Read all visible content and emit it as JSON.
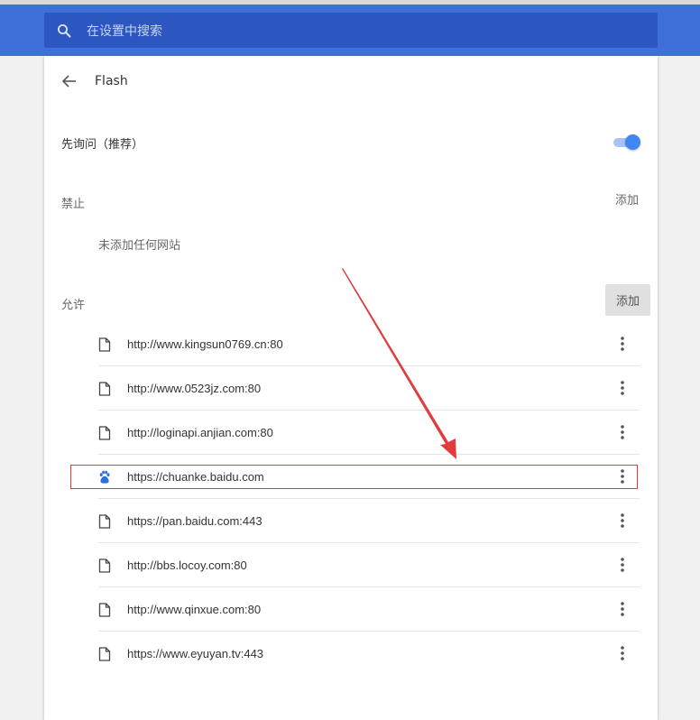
{
  "search": {
    "placeholder": "在设置中搜索"
  },
  "header": {
    "title": "Flash",
    "back_icon": "arrow-left-icon"
  },
  "ask_first": {
    "label": "先询问（推荐）",
    "enabled": true
  },
  "block": {
    "label": "禁止",
    "add_label": "添加",
    "empty_text": "未添加任何网站"
  },
  "allow": {
    "label": "允许",
    "add_label": "添加",
    "sites": [
      {
        "url": "http://www.kingsun0769.cn:80",
        "icon": "file-icon"
      },
      {
        "url": "http://www.0523jz.com:80",
        "icon": "file-icon"
      },
      {
        "url": "http://loginapi.anjian.com:80",
        "icon": "file-icon"
      },
      {
        "url": "https://chuanke.baidu.com",
        "icon": "baidu-paw-icon",
        "highlighted": true
      },
      {
        "url": "https://pan.baidu.com:443",
        "icon": "file-icon"
      },
      {
        "url": "http://bbs.locoy.com:80",
        "icon": "file-icon"
      },
      {
        "url": "http://www.qinxue.com:80",
        "icon": "file-icon"
      },
      {
        "url": "https://www.eyuyan.tv:443",
        "icon": "file-icon"
      }
    ]
  },
  "colors": {
    "header_bg": "#3f6fd9",
    "search_bg": "#2c57c1",
    "toggle_on": "#4285f4",
    "annotation": "#e03c3c",
    "baidu_blue": "#2f6ee0"
  }
}
